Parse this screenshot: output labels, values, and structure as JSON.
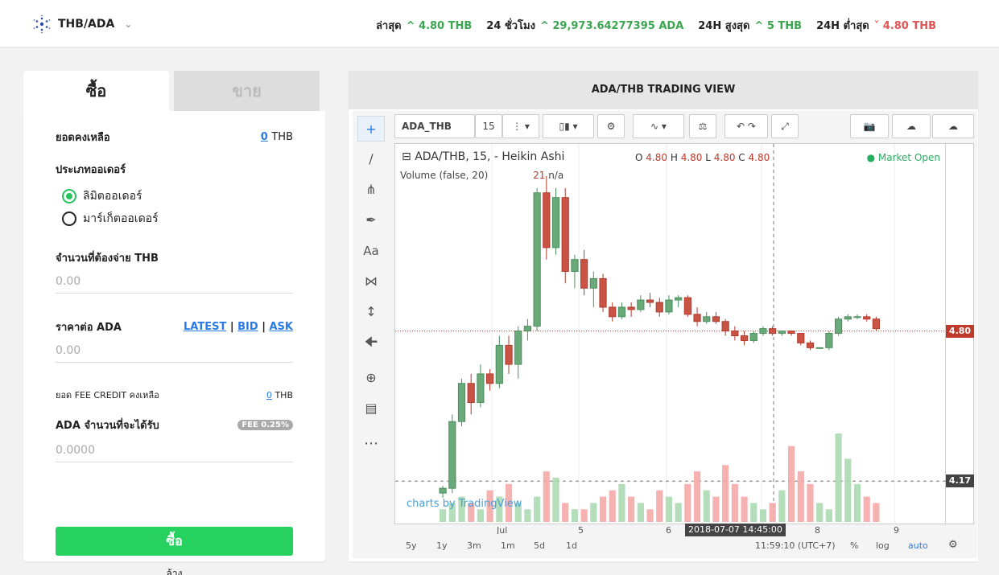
{
  "header": {
    "pair": "THB/ADA",
    "stats": [
      {
        "label": "ล่าสุด",
        "value": "^ 4.80 THB",
        "trend": "up"
      },
      {
        "label": "24 ชั่วโมง",
        "value": "^ 29,973.64277395 ADA",
        "trend": "up"
      },
      {
        "label": "24H สูงสุด",
        "value": "^ 5 THB",
        "trend": "up"
      },
      {
        "label": "24H ต่ำสุด",
        "value": "˅ 4.80 THB",
        "trend": "down"
      }
    ]
  },
  "order": {
    "tab_buy": "ซื้อ",
    "tab_sell": "ขาย",
    "balance_label": "ยอดคงเหลือ",
    "balance_value": "0",
    "balance_unit": "THB",
    "order_type_label": "ประเภทออเดอร์",
    "limit_label": "ลิมิตออเดอร์",
    "market_label": "มาร์เก็ตออเดอร์",
    "pay_label": "จำนวนที่ต้องจ่าย THB",
    "pay_placeholder": "0.00",
    "price_label": "ราคาต่อ ADA",
    "latest": "LATEST",
    "bid": "BID",
    "ask": "ASK",
    "sep": "|",
    "price_placeholder": "0.00",
    "fee_label": "ยอด FEE CREDIT คงเหลือ",
    "fee_value": "0",
    "fee_unit": "THB",
    "receive_label": "ADA จำนวนที่จะได้รับ",
    "fee_badge": "FEE 0.25%",
    "receive_placeholder": "0.0000",
    "buy_button": "ซื้อ",
    "clear": "ล้าง"
  },
  "chart_panel": {
    "title": "ADA/THB TRADING VIEW",
    "symbol": "ADA_THB",
    "interval": "15",
    "legend_main": "ADA/THB, 15, -  Heikin Ashi",
    "legend_volume": "Volume (false, 20)",
    "volume_value": "21",
    "volume_na": "n/a",
    "ohlc": {
      "o_label": "O",
      "o": "4.80",
      "h_label": "H",
      "h": "4.80",
      "l_label": "L",
      "l": "4.80",
      "c_label": "C",
      "c": "4.80"
    },
    "market_status": "● Market Open",
    "watermark": "charts by TradingView",
    "crosshair_time": "2018-07-07 14:45:00",
    "ranges": [
      "5y",
      "1y",
      "3m",
      "1m",
      "5d",
      "1d"
    ],
    "clock": "11:59:10 (UTC+7)",
    "scale_opts": [
      "%",
      "log",
      "auto"
    ]
  },
  "chart_data": {
    "type": "candlestick",
    "x_ticks": [
      "Jul",
      "5",
      "6",
      "8",
      "9"
    ],
    "price_labels": [
      {
        "value": 4.8,
        "color": "#c0392b"
      },
      {
        "value": 4.17,
        "color": "#444444"
      }
    ],
    "candles": [
      [
        4.12,
        4.15,
        4.1,
        4.14
      ],
      [
        4.14,
        4.45,
        4.12,
        4.42
      ],
      [
        4.42,
        4.6,
        4.4,
        4.58
      ],
      [
        4.58,
        4.62,
        4.45,
        4.5
      ],
      [
        4.5,
        4.66,
        4.48,
        4.62
      ],
      [
        4.62,
        4.64,
        4.55,
        4.58
      ],
      [
        4.58,
        4.78,
        4.56,
        4.74
      ],
      [
        4.74,
        4.78,
        4.62,
        4.66
      ],
      [
        4.66,
        4.82,
        4.6,
        4.8
      ],
      [
        4.8,
        4.85,
        4.76,
        4.82
      ],
      [
        4.82,
        5.4,
        4.8,
        5.38
      ],
      [
        5.38,
        5.45,
        5.1,
        5.15
      ],
      [
        5.15,
        5.4,
        5.12,
        5.36
      ],
      [
        5.36,
        5.4,
        5.0,
        5.05
      ],
      [
        5.05,
        5.12,
        4.98,
        5.1
      ],
      [
        5.1,
        5.14,
        4.95,
        4.98
      ],
      [
        4.98,
        5.05,
        4.9,
        5.02
      ],
      [
        5.02,
        5.04,
        4.88,
        4.9
      ],
      [
        4.9,
        4.92,
        4.84,
        4.86
      ],
      [
        4.86,
        4.92,
        4.85,
        4.9
      ],
      [
        4.9,
        4.92,
        4.86,
        4.89
      ],
      [
        4.89,
        4.95,
        4.88,
        4.93
      ],
      [
        4.93,
        4.96,
        4.9,
        4.92
      ],
      [
        4.92,
        4.94,
        4.86,
        4.88
      ],
      [
        4.88,
        4.95,
        4.87,
        4.93
      ],
      [
        4.93,
        4.95,
        4.9,
        4.94
      ],
      [
        4.94,
        4.95,
        4.86,
        4.87
      ],
      [
        4.87,
        4.9,
        4.82,
        4.84
      ],
      [
        4.84,
        4.88,
        4.83,
        4.86
      ],
      [
        4.86,
        4.88,
        4.83,
        4.84
      ],
      [
        4.84,
        4.85,
        4.78,
        4.8
      ],
      [
        4.8,
        4.82,
        4.76,
        4.78
      ],
      [
        4.78,
        4.8,
        4.74,
        4.76
      ],
      [
        4.76,
        4.8,
        4.75,
        4.79
      ],
      [
        4.79,
        4.82,
        4.78,
        4.81
      ],
      [
        4.81,
        4.82,
        4.78,
        4.79
      ],
      [
        4.79,
        4.8,
        4.78,
        4.8
      ],
      [
        4.8,
        4.8,
        4.78,
        4.79
      ],
      [
        4.79,
        4.79,
        4.74,
        4.75
      ],
      [
        4.75,
        4.76,
        4.72,
        4.73
      ],
      [
        4.73,
        4.73,
        4.73,
        4.73
      ],
      [
        4.73,
        4.8,
        4.72,
        4.79
      ],
      [
        4.79,
        4.86,
        4.78,
        4.85
      ],
      [
        4.85,
        4.87,
        4.84,
        4.86
      ],
      [
        4.86,
        4.87,
        4.85,
        4.86
      ],
      [
        4.86,
        4.87,
        4.84,
        4.85
      ],
      [
        4.85,
        4.86,
        4.8,
        4.81
      ]
    ],
    "volumes": [
      2,
      3,
      4,
      3,
      2,
      5,
      4,
      6,
      3,
      2,
      4,
      8,
      7,
      3,
      2,
      2,
      3,
      4,
      5,
      6,
      4,
      3,
      2,
      5,
      4,
      3,
      6,
      8,
      5,
      4,
      9,
      6,
      4,
      3,
      2,
      3,
      5,
      12,
      8,
      6,
      3,
      2,
      14,
      10,
      6,
      4,
      3
    ],
    "ylim": [
      4.1,
      5.45
    ]
  }
}
